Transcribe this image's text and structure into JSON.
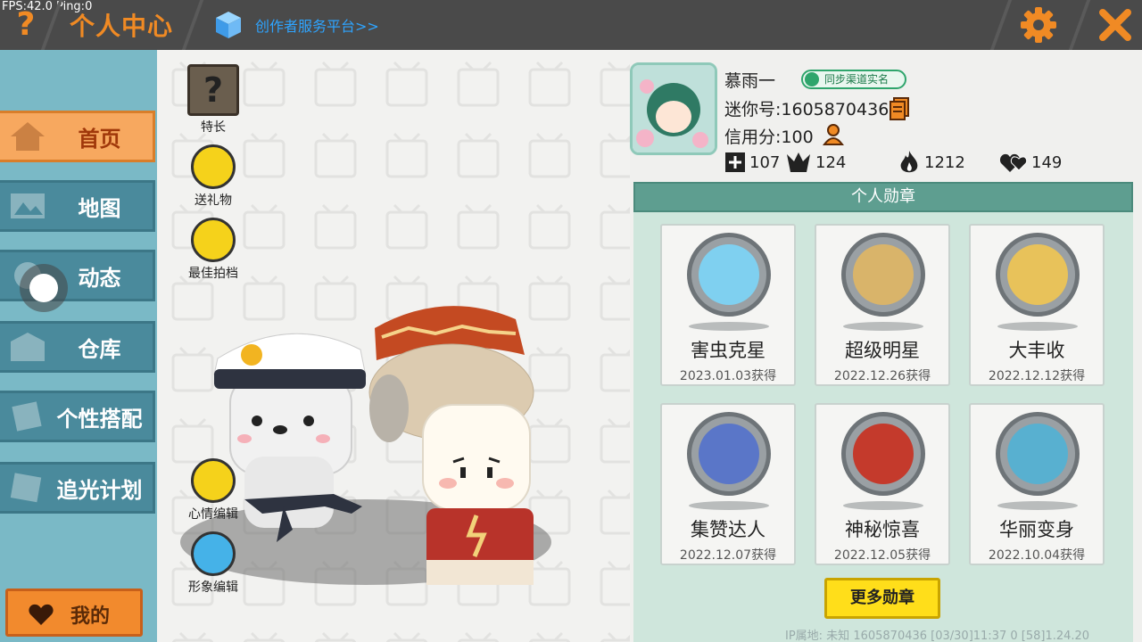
{
  "status": {
    "fps_ping": "FPS:42.0  Ping:0"
  },
  "header": {
    "help_glyph": "?",
    "title": "个人中心",
    "creator_link": "创作者服务平台>>"
  },
  "sidebar": {
    "items": [
      {
        "label": "首页",
        "icon": "home-icon",
        "active": true
      },
      {
        "label": "地图",
        "icon": "map-icon",
        "active": false
      },
      {
        "label": "动态",
        "icon": "feed-icon",
        "active": false
      },
      {
        "label": "仓库",
        "icon": "warehouse-icon",
        "active": false
      },
      {
        "label": "个性搭配",
        "icon": "outfit-icon",
        "active": false
      },
      {
        "label": "追光计划",
        "icon": "spotlight-icon",
        "active": false
      }
    ],
    "mine_label": "我的"
  },
  "tools": {
    "specialty": "特长",
    "gift": "送礼物",
    "best_partner": "最佳拍档",
    "mood_edit": "心情编辑",
    "look_edit": "形象编辑"
  },
  "profile": {
    "name": "慕雨一",
    "realname_badge": "同步渠道实名",
    "mini_id": "迷你号:1605870436",
    "credit": "信用分:100",
    "stats": {
      "likes": "107",
      "fans": "124",
      "hot": "1212",
      "popularity": "149"
    }
  },
  "medals": {
    "header": "个人勋章",
    "items": [
      {
        "name": "害虫克星",
        "date": "2023.01.03获得",
        "color": "#7fd0f0"
      },
      {
        "name": "超级明星",
        "date": "2022.12.26获得",
        "color": "#d9b46a"
      },
      {
        "name": "大丰收",
        "date": "2022.12.12获得",
        "color": "#e8c25a"
      },
      {
        "name": "集赞达人",
        "date": "2022.12.07获得",
        "color": "#5a76c8"
      },
      {
        "name": "神秘惊喜",
        "date": "2022.12.05获得",
        "color": "#c43a2c"
      },
      {
        "name": "华丽变身",
        "date": "2022.10.04获得",
        "color": "#58b0d0"
      }
    ],
    "more_button": "更多勋章"
  },
  "footer": {
    "text": "IP属地: 未知    1605870436   [03/30]11:37 0  [58]1.24.20"
  },
  "colors": {
    "accent_orange": "#f08a24",
    "sidebar_bg": "#7ab9c6",
    "nav_bg": "#4a8a9c",
    "panel_bg": "#cfe6dc"
  }
}
